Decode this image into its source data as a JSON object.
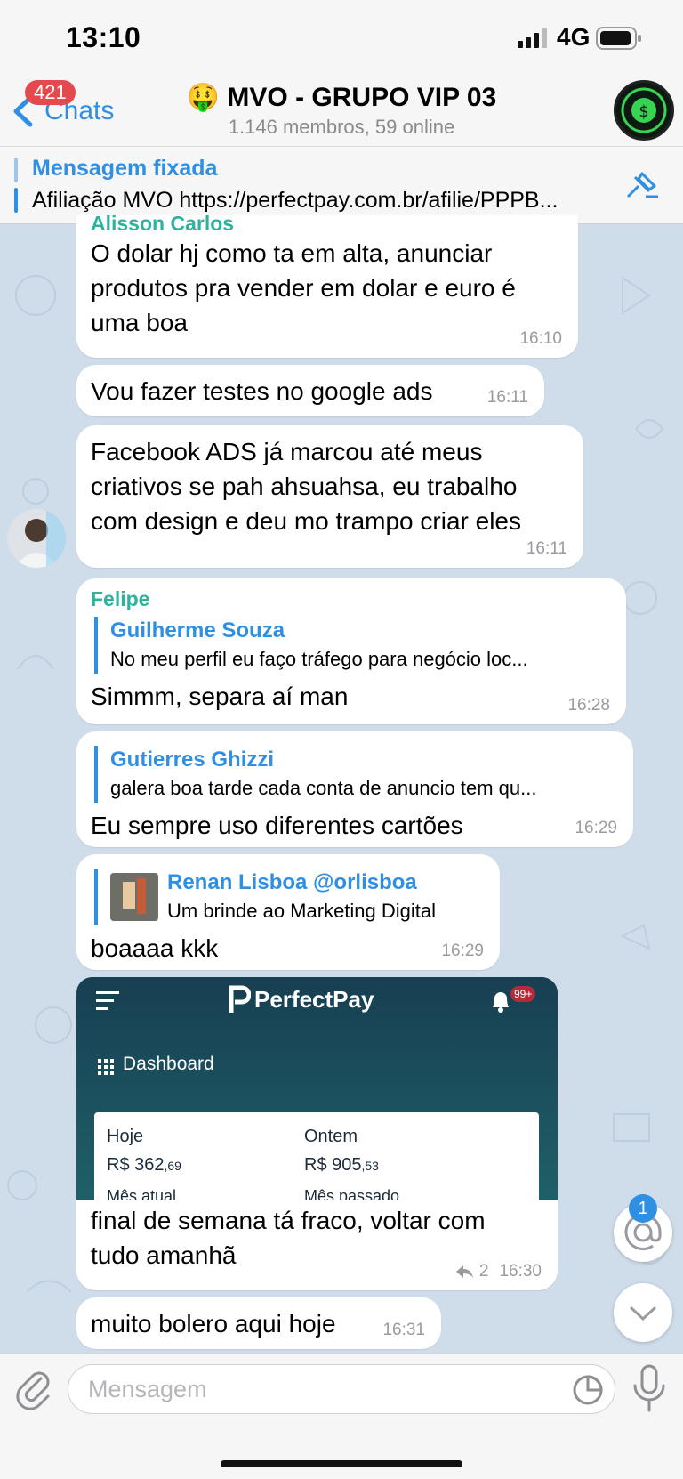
{
  "status_bar": {
    "time": "13:10",
    "network": "4G"
  },
  "header": {
    "back_badge": "421",
    "back_label": "Chats",
    "title_emoji": "🤑",
    "title": "MVO - GRUPO VIP 03",
    "subtitle": "1.146 membros, 59 online"
  },
  "pinned": {
    "title": "Mensagem fixada",
    "text": "Afiliação MVO https://perfectpay.com.br/afilie/PPPB..."
  },
  "messages": [
    {
      "sender": "Alisson Carlos",
      "text_lines": [
        "O dolar hj como ta em alta, anunciar",
        "produtos pra vender em dolar e euro é",
        "uma boa"
      ],
      "time": "16:10"
    },
    {
      "text": "Vou fazer testes no google ads",
      "time": "16:11"
    },
    {
      "text_lines": [
        "Facebook ADS já marcou até meus",
        "criativos se pah ahsuahsa, eu trabalho",
        "com design e deu mo trampo criar eles"
      ],
      "time": "16:11"
    },
    {
      "sender": "Felipe",
      "reply_name": "Guilherme Souza",
      "reply_text": "No meu perfil eu faço tráfego para negócio loc...",
      "text": "Simmm, separa aí man",
      "time": "16:28"
    },
    {
      "reply_name": "Gutierres Ghizzi",
      "reply_text": "galera boa tarde cada conta de anuncio tem qu...",
      "text": "Eu sempre uso diferentes cartões",
      "time": "16:29"
    },
    {
      "reply_name": "Renan Lisboa @orlisboa",
      "reply_text": "Um brinde ao Marketing Digital",
      "text": "boaaaa kkk",
      "time": "16:29"
    },
    {
      "image": {
        "brand": "PerfectPay",
        "badge": "99+",
        "menu": "Dashboard",
        "col1_label": "Hoje",
        "col1_value": "R$ 362",
        "col1_cents": ",69",
        "col2_label": "Ontem",
        "col2_value": "R$ 905",
        "col2_cents": ",53",
        "row2_col1": "Mês atual",
        "row2_col2": "Mês passado"
      },
      "text_lines": [
        "final de semana tá fraco, voltar com",
        "tudo amanhã"
      ],
      "replies": "2",
      "time": "16:30"
    },
    {
      "text": "muito bolero aqui hoje",
      "time": "16:31"
    }
  ],
  "mentions_badge": "1",
  "input": {
    "placeholder": "Mensagem"
  },
  "colors": {
    "accent": "#2f8fe3",
    "sender_green": "#2db39c",
    "badge_red": "#e5484d",
    "chat_bg": "#cfdcea"
  }
}
